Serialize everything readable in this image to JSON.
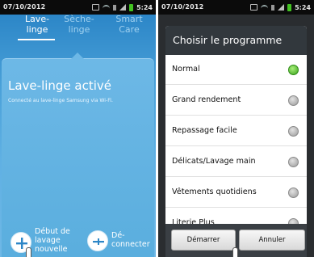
{
  "left_screen": {
    "status": {
      "date": "07/10/2012",
      "time": "5:24"
    },
    "tabs": [
      {
        "label_line1": "Lave-",
        "label_line2": "linge"
      },
      {
        "label_line1": "Sèche-",
        "label_line2": "linge"
      },
      {
        "label_line1": "Smart",
        "label_line2": "Care"
      }
    ],
    "title": "Lave-linge activé",
    "subtitle": "Connecté au lave-linge Samsung via Wi-Fi.",
    "start_button": {
      "line1": "Début de",
      "line2": "lavage",
      "line3": "nouvelle"
    },
    "disconnect_button": {
      "line1": "Dé-",
      "line2": "connecter"
    }
  },
  "right_screen": {
    "status": {
      "date": "07/10/2012",
      "time": "5:24"
    },
    "dialog_title": "Choisir le programme",
    "options": [
      {
        "label": "Normal",
        "selected": true
      },
      {
        "label": "Grand rendement",
        "selected": false
      },
      {
        "label": "Repassage facile",
        "selected": false
      },
      {
        "label": "Délicats/Lavage main",
        "selected": false
      },
      {
        "label": "Vêtements quotidiens",
        "selected": false
      },
      {
        "label": "Literie Plus",
        "selected": false
      }
    ],
    "buttons": {
      "start": "Démarrer",
      "cancel": "Annuler"
    }
  },
  "colors": {
    "accent_blue": "#2c86c7",
    "panel_blue": "#6db8e6",
    "radio_selected": "#3aa21c",
    "dialog_header": "#32383d"
  }
}
